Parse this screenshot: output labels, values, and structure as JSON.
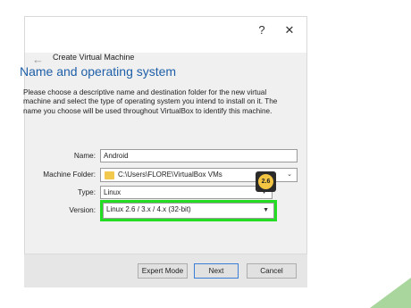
{
  "titlebar": {
    "help": "?",
    "close": "✕"
  },
  "header": {
    "back_arrow": "←",
    "title": "Create Virtual Machine"
  },
  "section": {
    "heading": "Name and operating system"
  },
  "description": "Please choose a descriptive name and destination folder for the new virtual machine and select the type of operating system you intend to install on it. The name you choose will be used throughout VirtualBox to identify this machine.",
  "form": {
    "name_label": "Name:",
    "name_value": "Android",
    "folder_label": "Machine Folder:",
    "folder_value": "C:\\Users\\FLORE\\VirtualBox VMs",
    "type_label": "Type:",
    "type_value": "Linux",
    "version_label": "Version:",
    "version_value": "Linux 2.6 / 3.x / 4.x (32-bit)",
    "os_badge": "2.6"
  },
  "buttons": {
    "expert": "Expert Mode",
    "next": "Next",
    "cancel": "Cancel"
  },
  "icons": {
    "dropdown": "▼"
  },
  "colors": {
    "highlight": "#22dd22",
    "heading": "#1e5fa8"
  }
}
